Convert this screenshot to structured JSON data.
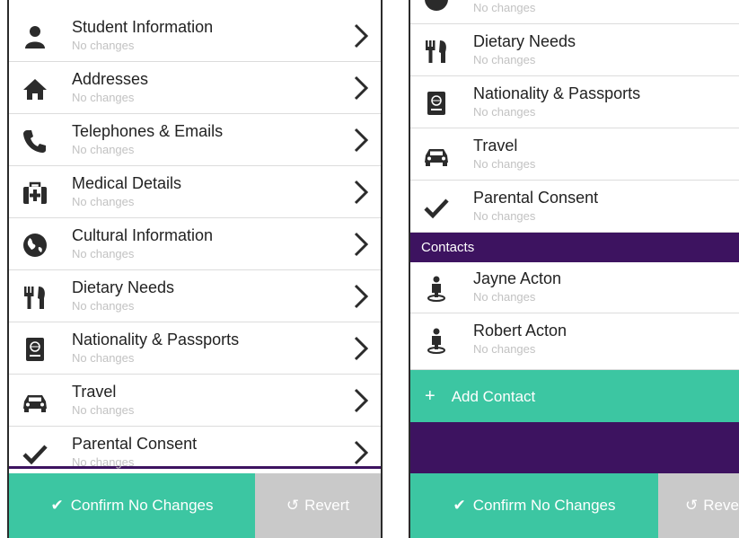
{
  "left": {
    "items": [
      {
        "icon": "person-icon",
        "title": "Student Information",
        "subtitle": "No changes"
      },
      {
        "icon": "house-icon",
        "title": "Addresses",
        "subtitle": "No changes"
      },
      {
        "icon": "phone-icon",
        "title": "Telephones & Emails",
        "subtitle": "No changes"
      },
      {
        "icon": "medical-kit-icon",
        "title": "Medical Details",
        "subtitle": "No changes"
      },
      {
        "icon": "globe-icon",
        "title": "Cultural Information",
        "subtitle": "No changes"
      },
      {
        "icon": "fork-knife-icon",
        "title": "Dietary Needs",
        "subtitle": "No changes"
      },
      {
        "icon": "passport-icon",
        "title": "Nationality & Passports",
        "subtitle": "No changes"
      },
      {
        "icon": "car-icon",
        "title": "Travel",
        "subtitle": "No changes"
      },
      {
        "icon": "checkmark-icon",
        "title": "Parental Consent",
        "subtitle": "No changes"
      }
    ],
    "footer": {
      "confirm_label": "Confirm No Changes",
      "revert_label": "Revert"
    }
  },
  "right": {
    "top_partial_subtitle": "No changes",
    "items": [
      {
        "icon": "fork-knife-icon",
        "title": "Dietary Needs",
        "subtitle": "No changes"
      },
      {
        "icon": "passport-icon",
        "title": "Nationality & Passports",
        "subtitle": "No changes"
      },
      {
        "icon": "car-icon",
        "title": "Travel",
        "subtitle": "No changes"
      },
      {
        "icon": "checkmark-icon",
        "title": "Parental Consent",
        "subtitle": "No changes"
      }
    ],
    "contacts_header": "Contacts",
    "contacts": [
      {
        "icon": "contact-person-icon",
        "title": "Jayne Acton",
        "subtitle": "No changes"
      },
      {
        "icon": "contact-person-icon",
        "title": "Robert Acton",
        "subtitle": "No changes"
      }
    ],
    "add_contact_label": "Add Contact",
    "footer": {
      "confirm_label": "Confirm No Changes",
      "revert_label": "Reve"
    }
  },
  "colors": {
    "accent_green": "#3cc6a2",
    "purple": "#3d1360",
    "revert_grey": "#c9c9c9",
    "icon_dark": "#2b2b2b"
  }
}
